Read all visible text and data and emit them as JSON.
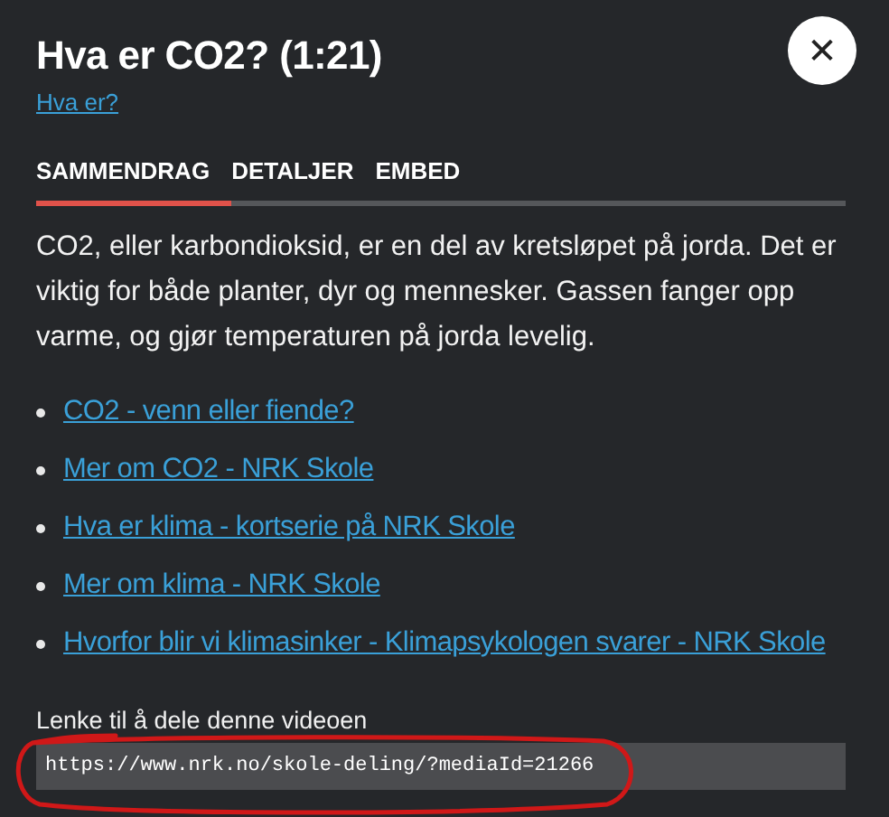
{
  "title": "Hva er CO2? (1:21)",
  "subtitle_link": "Hva er?",
  "close_button": "✕",
  "tabs": [
    {
      "label": "SAMMENDRAG",
      "selected": true
    },
    {
      "label": "DETALJER",
      "selected": false
    },
    {
      "label": "EMBED",
      "selected": false
    }
  ],
  "summary": "CO2, eller karbondioksid, er en del av kretsløpet på jorda. Det er viktig for både planter, dyr og mennesker. Gassen fanger opp varme, og gjør temperaturen på jorda levelig.",
  "links": [
    "CO2 - venn eller fiende?",
    "Mer om CO2 - NRK Skole",
    "Hva er klima - kortserie på NRK Skole",
    "Mer om klima - NRK Skole",
    "Hvorfor blir vi klimasinker - Klimapsykologen svarer - NRK Skole"
  ],
  "share": {
    "label": "Lenke til å dele denne videoen",
    "url": "https://www.nrk.no/skole-deling/?mediaId=21266"
  }
}
